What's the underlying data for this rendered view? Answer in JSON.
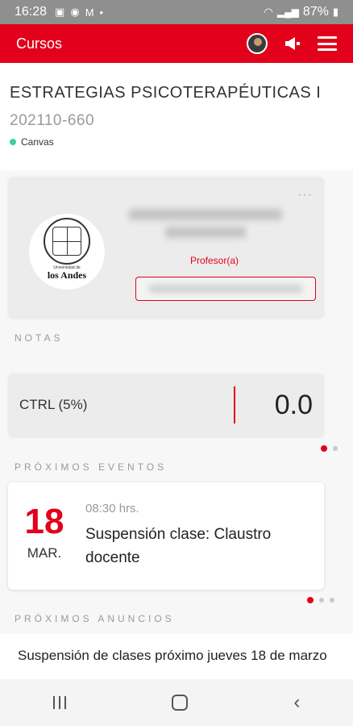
{
  "status_bar": {
    "time": "16:28",
    "battery": "87%",
    "icons": [
      "image-icon",
      "chrome-icon",
      "gmail-icon",
      "dot-icon"
    ]
  },
  "appbar": {
    "title": "Cursos",
    "icons": [
      "avatar",
      "megaphone-icon",
      "menu-icon"
    ]
  },
  "course": {
    "title": "ESTRATEGIAS PSICOTERAPÉUTICAS I",
    "code": "202110-660",
    "platform": "Canvas"
  },
  "teacher": {
    "logo_text": "Universidad de",
    "logo_name": "los Andes",
    "role": "Profesor(a)"
  },
  "grades": {
    "section_label": "NOTAS",
    "items": [
      {
        "name": "CTRL (5%)",
        "value": "0.0"
      }
    ]
  },
  "events": {
    "section_label": "PRÓXIMOS EVENTOS",
    "items": [
      {
        "day": "18",
        "month": "MAR.",
        "time": "08:30 hrs.",
        "title": "Suspensión clase: Claustro docente"
      }
    ]
  },
  "announcements": {
    "section_label": "PRÓXIMOS ANUNCIOS",
    "items": [
      {
        "text": "Suspensión de clases próximo jueves 18 de marzo"
      }
    ]
  },
  "colors": {
    "brand": "#e2001a",
    "platform_dot": "#3ccfa0"
  }
}
